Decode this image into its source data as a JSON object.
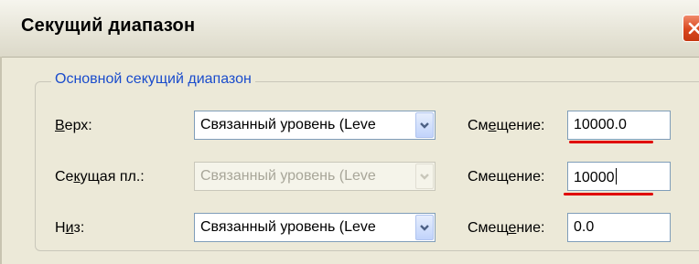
{
  "window": {
    "title": "Секущий диапазон"
  },
  "group": {
    "legend": "Основной секущий диапазон"
  },
  "rows": [
    {
      "label_pre": "",
      "label_ul": "В",
      "label_post": "ерх:",
      "combo_value": "Связанный уровень (Leve",
      "enabled": true,
      "offset_label_pre": "См",
      "offset_label_ul": "е",
      "offset_label_post": "щение:",
      "offset_value": "10000.0"
    },
    {
      "label_pre": "Се",
      "label_ul": "к",
      "label_post": "ущая пл.:",
      "combo_value": "Связанный уровень (Leve",
      "enabled": false,
      "offset_label_pre": "Смещение:",
      "offset_label_ul": "",
      "offset_label_post": "",
      "offset_value": "10000"
    },
    {
      "label_pre": "Н",
      "label_ul": "и",
      "label_post": "з:",
      "combo_value": "Связанный уровень (Leve",
      "enabled": true,
      "offset_label_pre": "Смещ",
      "offset_label_ul": "е",
      "offset_label_post": "ние:",
      "offset_value": "0.0"
    }
  ],
  "colors": {
    "legend": "#1a4ccc",
    "annotation": "#e00000",
    "close_button": "#d9461e"
  },
  "icons": {
    "close": "close-x-icon",
    "dropdown": "chevron-down-icon"
  }
}
